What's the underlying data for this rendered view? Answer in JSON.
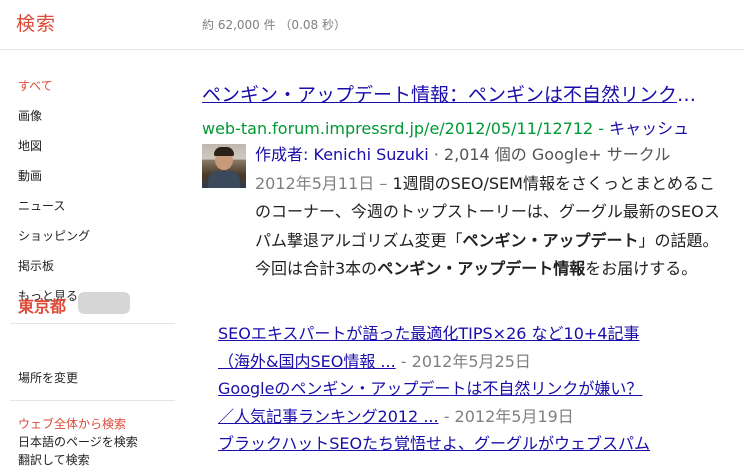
{
  "header": {
    "title": "検索",
    "stats": "約 62,000 件 （0.08 秒）"
  },
  "sidebar": {
    "items": [
      {
        "label": "すべて",
        "active": true
      },
      {
        "label": "画像"
      },
      {
        "label": "地図"
      },
      {
        "label": "動画"
      },
      {
        "label": "ニュース"
      },
      {
        "label": "ショッピング"
      },
      {
        "label": "掲示板"
      },
      {
        "label": "もっと見る"
      }
    ],
    "location": {
      "name": "東京都",
      "change_label": "場所を変更"
    },
    "search_scope": {
      "heading": "ウェブ全体から検索",
      "options": [
        "日本語のページを検索",
        "翻訳して検索"
      ]
    }
  },
  "result": {
    "title": "ペンギン・アップデート情報：ペンギンは不自然リンクが嫌い？",
    "url": "web-tan.forum.impressrd.jp/e/2012/05/11/12712",
    "cache_label": "キャッシュ",
    "author_label": "作成者:",
    "author_name": "Kenichi Suzuki",
    "circles": "· 2,014 個の Google+ サークル",
    "date": "2012年5月11日 –",
    "snippet_part1": "1週間のSEO/SEM情報をさくっとまとめるこのコーナー、今週のトップストーリーは、グーグル最新のSEOスパム撃退アルゴリズム変更「",
    "snippet_bold1": "ペンギン・アップデート",
    "snippet_part2": "」の話題。今回は合計3本の",
    "snippet_bold2": "ペンギン・アップデート情報",
    "snippet_part3": "をお届けする。",
    "sub_results": [
      {
        "line1": "SEOエキスパートが語った最適化TIPS×26 など10+4記事",
        "line2": "（海外&国内SEO情報 ...",
        "date": "- 2012年5月25日"
      },
      {
        "line1": "Googleのペンギン・アップデートは不自然リンクが嫌い？",
        "line2": "／人気記事ランキング2012 ...",
        "date": "- 2012年5月19日"
      },
      {
        "line1": "ブラックハットSEOたち覚悟せよ、グーグルがウェブスパム"
      }
    ]
  },
  "colors": {
    "accent": "#dd4b39",
    "link": "#1a0dab",
    "url_green": "#009933",
    "muted": "#808080"
  }
}
